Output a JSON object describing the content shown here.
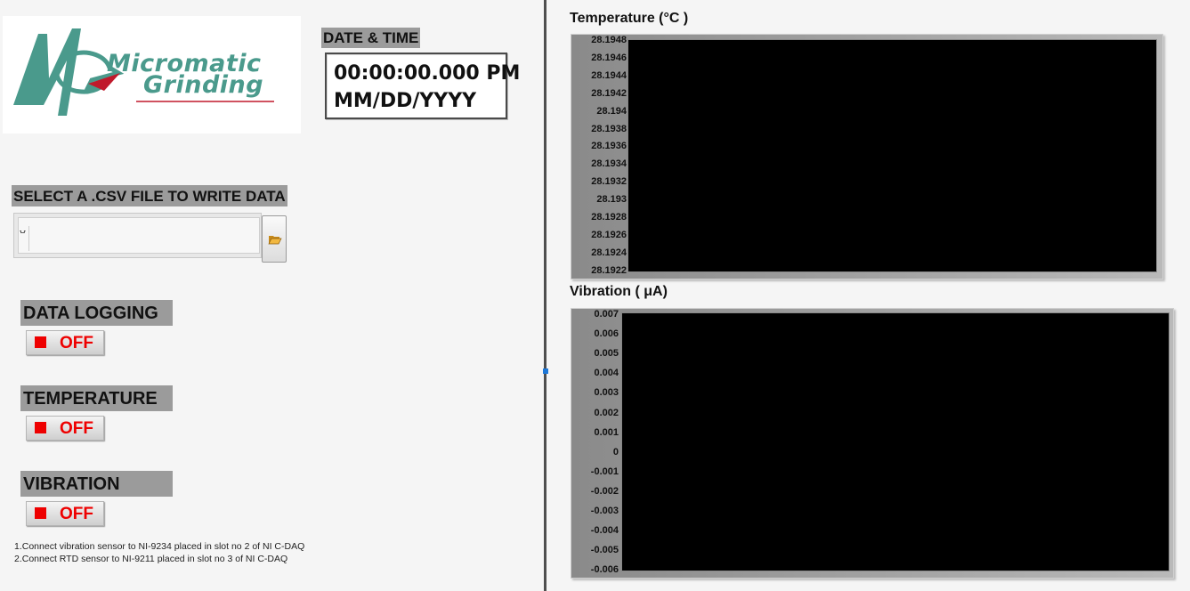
{
  "logo": {
    "text_line1": "Micromatic",
    "text_line2": "Grinding"
  },
  "datetime": {
    "label": "DATE & TIME",
    "time": "00:00:00.000 PM",
    "date": "MM/DD/YYYY"
  },
  "file": {
    "label": "SELECT A .CSV FILE TO WRITE DATA",
    "path_value": "",
    "path_icon": "␀",
    "browse_icon": "folder-open-icon"
  },
  "controls": {
    "data_logging": {
      "label": "DATA LOGGING",
      "state": "OFF"
    },
    "temperature": {
      "label": "TEMPERATURE",
      "state": "OFF"
    },
    "vibration": {
      "label": "VIBRATION",
      "state": "OFF"
    }
  },
  "notes": [
    "1.Connect vibration sensor to NI-9234 placed in slot no 2 of NI C-DAQ",
    "2.Connect RTD sensor to NI-9211 placed in slot no 3 of NI C-DAQ"
  ],
  "charts": {
    "temperature": {
      "title": "Temperature (°C )",
      "ticks": [
        "28.1948",
        "28.1946",
        "28.1944",
        "28.1942",
        "28.194",
        "28.1938",
        "28.1936",
        "28.1934",
        "28.1932",
        "28.193",
        "28.1928",
        "28.1926",
        "28.1924",
        "28.1922"
      ]
    },
    "vibration": {
      "title": "Vibration ( μA)",
      "ticks": [
        "0.007",
        "0.006",
        "0.005",
        "0.004",
        "0.003",
        "0.002",
        "0.001",
        "0",
        "-0.001",
        "-0.002",
        "-0.003",
        "-0.004",
        "-0.005",
        "-0.006"
      ]
    }
  },
  "colors": {
    "accent_teal": "#4a9a8c",
    "off_red": "#ee0000",
    "label_gray": "#9b9b9b",
    "plot_bg": "#000000"
  }
}
